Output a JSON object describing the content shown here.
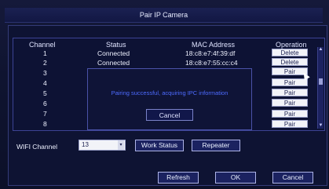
{
  "window": {
    "title": "Pair IP Camera"
  },
  "table": {
    "headers": {
      "channel": "Channel",
      "status": "Status",
      "mac": "MAC Address",
      "operation": "Operation"
    },
    "rows": [
      {
        "channel": "1",
        "status": "Connected",
        "mac": "18:c8:e7:4f:39:df",
        "op": "Delete"
      },
      {
        "channel": "2",
        "status": "Connected",
        "mac": "18:c8:e7:55:cc:c4",
        "op": "Delete"
      },
      {
        "channel": "3",
        "status": "",
        "mac": "",
        "op": "Pair"
      },
      {
        "channel": "4",
        "status": "",
        "mac": "",
        "op": "Pair"
      },
      {
        "channel": "5",
        "status": "",
        "mac": "",
        "op": "Pair"
      },
      {
        "channel": "6",
        "status": "",
        "mac": "",
        "op": "Pair"
      },
      {
        "channel": "7",
        "status": "",
        "mac": "",
        "op": "Pair"
      },
      {
        "channel": "8",
        "status": "",
        "mac": "",
        "op": "Pair"
      }
    ]
  },
  "pairing_dialog": {
    "message": "Pairing successful, acquiring IPC information",
    "cancel_label": "Cancel"
  },
  "wifi": {
    "label": "WIFI Channel",
    "value": "13",
    "work_status_label": "Work Status",
    "repeater_label": "Repeater"
  },
  "footer": {
    "refresh_label": "Refresh",
    "ok_label": "OK",
    "cancel_label": "Cancel"
  }
}
